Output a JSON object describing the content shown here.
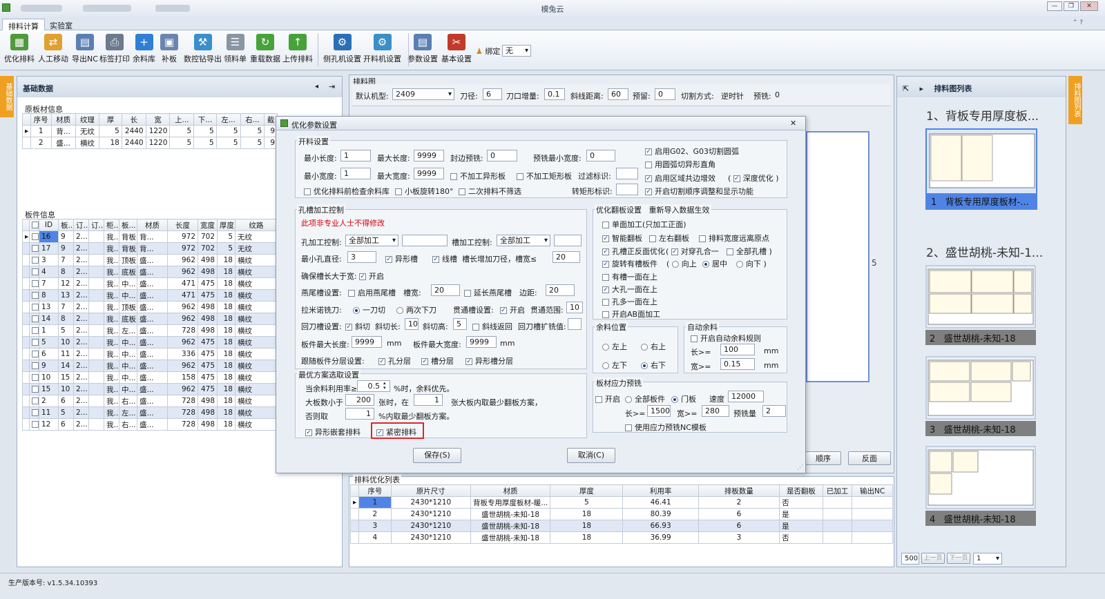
{
  "window": {
    "title": "模兔云",
    "min": "—",
    "max": "❐",
    "close": "✕"
  },
  "ribbon_tabs": [
    "排料计算",
    "实验室"
  ],
  "toolbar": [
    {
      "label": "优化排料",
      "color": "#4f9a3c",
      "glyph": "▦"
    },
    {
      "label": "人工移动",
      "color": "#e0a030",
      "glyph": "⇄"
    },
    {
      "label": "导出NC",
      "color": "#5b7fb4",
      "glyph": "▤"
    },
    {
      "label": "标签打印",
      "color": "#6b7a8c",
      "glyph": "⎙"
    },
    {
      "label": "余料库",
      "color": "#2f7fd4",
      "glyph": "+"
    },
    {
      "label": "补板",
      "color": "#6a86b0",
      "glyph": "▣"
    },
    {
      "label": "数控钻导出",
      "color": "#3a8fc9",
      "glyph": "⚒"
    },
    {
      "label": "领料单",
      "color": "#8a95a3",
      "glyph": "☰"
    },
    {
      "label": "重载数据",
      "color": "#46a33a",
      "glyph": "↻"
    },
    {
      "label": "上传排料",
      "color": "#46a33a",
      "glyph": "↑"
    },
    {
      "label": "侧孔机设置",
      "color": "#2b6fb8",
      "glyph": "⚙"
    },
    {
      "label": "开料机设置",
      "color": "#3a8fc9",
      "glyph": "⚙"
    },
    {
      "label": "参数设置",
      "color": "#5b7fb4",
      "glyph": "▤"
    },
    {
      "label": "基本设置",
      "color": "#c23a2a",
      "glyph": "✂"
    }
  ],
  "bind": {
    "label": "绑定",
    "value": "无"
  },
  "left_panel": {
    "title": "基础数据",
    "side_tab": "基础数据",
    "raw_title": "原板材信息",
    "raw_headers": [
      "序号",
      "材质",
      "纹理",
      "厚",
      "长",
      "宽",
      "上...",
      "下...",
      "左...",
      "右...",
      "截"
    ],
    "raw_rows": [
      [
        "1",
        "背...",
        "无纹",
        "5",
        "2440",
        "1220",
        "5",
        "5",
        "5",
        "5",
        "9"
      ],
      [
        "2",
        "盛...",
        "横纹",
        "18",
        "2440",
        "1220",
        "5",
        "5",
        "5",
        "5",
        "9"
      ]
    ],
    "parts_title": "板件信息",
    "parts_headers": [
      "",
      "ID",
      "板...",
      "订...",
      "订...",
      "柜...",
      "板...",
      "材质",
      "长度",
      "宽度",
      "厚度",
      "纹路"
    ],
    "parts_rows": [
      [
        "16",
        "9",
        "2...",
        "",
        "我...",
        "背板",
        "背...",
        "972",
        "702",
        "5",
        "无纹"
      ],
      [
        "17",
        "9",
        "2...",
        "",
        "我...",
        "背板",
        "背...",
        "972",
        "702",
        "5",
        "无纹"
      ],
      [
        "3",
        "7",
        "2...",
        "",
        "我...",
        "顶板",
        "盛...",
        "962",
        "498",
        "18",
        "横纹"
      ],
      [
        "4",
        "8",
        "2...",
        "",
        "我...",
        "底板",
        "盛...",
        "962",
        "498",
        "18",
        "横纹"
      ],
      [
        "7",
        "12",
        "2...",
        "",
        "我...",
        "中...",
        "盛...",
        "471",
        "475",
        "18",
        "横纹"
      ],
      [
        "8",
        "13",
        "2...",
        "",
        "我...",
        "中...",
        "盛...",
        "471",
        "475",
        "18",
        "横纹"
      ],
      [
        "13",
        "7",
        "2...",
        "",
        "我...",
        "顶板",
        "盛...",
        "962",
        "498",
        "18",
        "横纹"
      ],
      [
        "14",
        "8",
        "2...",
        "",
        "我...",
        "底板",
        "盛...",
        "962",
        "498",
        "18",
        "横纹"
      ],
      [
        "1",
        "5",
        "2...",
        "",
        "我...",
        "左...",
        "盛...",
        "728",
        "498",
        "18",
        "横纹"
      ],
      [
        "5",
        "10",
        "2...",
        "",
        "我...",
        "中...",
        "盛...",
        "962",
        "475",
        "18",
        "横纹"
      ],
      [
        "6",
        "11",
        "2...",
        "",
        "我...",
        "中...",
        "盛...",
        "336",
        "475",
        "18",
        "横纹"
      ],
      [
        "9",
        "14",
        "2...",
        "",
        "我...",
        "中...",
        "盛...",
        "962",
        "475",
        "18",
        "横纹"
      ],
      [
        "10",
        "15",
        "2...",
        "",
        "我...",
        "中...",
        "盛...",
        "158",
        "475",
        "18",
        "横纹"
      ],
      [
        "15",
        "10",
        "2...",
        "",
        "我...",
        "中...",
        "盛...",
        "962",
        "475",
        "18",
        "横纹"
      ],
      [
        "2",
        "6",
        "2...",
        "",
        "我...",
        "右...",
        "盛...",
        "728",
        "498",
        "18",
        "横纹"
      ],
      [
        "11",
        "5",
        "2...",
        "",
        "我...",
        "左...",
        "盛...",
        "728",
        "498",
        "18",
        "横纹"
      ],
      [
        "12",
        "6",
        "2...",
        "",
        "我...",
        "右...",
        "盛...",
        "728",
        "498",
        "18",
        "横纹"
      ]
    ]
  },
  "layout_panel": {
    "title": "排料图",
    "machine_label": "默认机型:",
    "machine_value": "2409",
    "knife_label": "刀径:",
    "knife_value": "6",
    "margin_label": "刀口增量:",
    "margin_value": "0.1",
    "slope_label": "斜线距离:",
    "slope_value": "60",
    "reserve_label": "预留:",
    "reserve_value": "0",
    "cut_label": "切割方式:",
    "cut_value": "逆时针",
    "pre_label": "预铣:",
    "pre_value": "0",
    "board_mark": "5",
    "btn_order": "顺序",
    "btn_back": "反面"
  },
  "opt_list": {
    "title": "排料优化列表",
    "headers": [
      "",
      "序号",
      "原片尺寸",
      "材质",
      "厚度",
      "利用率",
      "排板数量",
      "是否翻板",
      "已加工",
      "输出NC"
    ],
    "rows": [
      [
        "1",
        "2430*1210",
        "背板专用厚度板材-暖...",
        "5",
        "46.41",
        "2",
        "否",
        "",
        ""
      ],
      [
        "2",
        "2430*1210",
        "盛世胡桃-未知-18",
        "18",
        "80.39",
        "6",
        "是",
        "",
        ""
      ],
      [
        "3",
        "2430*1210",
        "盛世胡桃-未知-18",
        "18",
        "66.93",
        "6",
        "是",
        "",
        ""
      ],
      [
        "4",
        "2430*1210",
        "盛世胡桃-未知-18",
        "18",
        "36.99",
        "3",
        "否",
        "",
        ""
      ]
    ]
  },
  "right_panel": {
    "title": "排料图列表",
    "side_tab": "排料图列表",
    "groups": [
      {
        "heading": "1、背板专用厚度板...",
        "cards": [
          {
            "num": "1",
            "name": "背板专用厚度板材-..."
          }
        ]
      },
      {
        "heading": "2、盛世胡桃-未知-1...",
        "cards": [
          {
            "num": "2",
            "name": "盛世胡桃-未知-18"
          },
          {
            "num": "3",
            "name": "盛世胡桃-未知-18"
          },
          {
            "num": "4",
            "name": "盛世胡桃-未知-18"
          }
        ]
      }
    ],
    "pager": {
      "size": "500",
      "prev": "上一页",
      "next": "下一页",
      "page": "1"
    }
  },
  "dialog": {
    "title": "优化参数设置",
    "close": "✕",
    "g_cut": "开料设置",
    "min_len": "最小长度:",
    "min_len_v": "1",
    "max_len": "最大长度:",
    "max_len_v": "9999",
    "edge_pre": "封边预铣:",
    "edge_pre_v": "0",
    "pre_min_w": "预铣最小宽度:",
    "pre_min_w_v": "0",
    "min_w": "最小宽度:",
    "min_w_v": "1",
    "max_w": "最大宽度:",
    "max_w_v": "9999",
    "no_shape": "不加工异形板",
    "no_rect": "不加工矩形板",
    "filter_mark": "过滤标识:",
    "rot_mark": "转矩形标识:",
    "check_remain": "优化排料前检查余料库",
    "rot180": "小板旋转180°",
    "second": "二次排料不筛选",
    "g02": "启用G02、G03切割圆弧",
    "arc": "用圆弧切异形直角",
    "region": "启用区域共边增效",
    "deep": "深度优化",
    "order_fn": "开启切割顺序调整和显示功能",
    "g_hole": "孔槽加工控制",
    "warn": "此项非专业人士不得修改",
    "hole_ctrl": "孔加工控制:",
    "hole_ctrl_v": "全部加工",
    "slot_ctrl": "槽加工控制:",
    "slot_ctrl_v": "全部加工",
    "min_dia": "最小孔直径:",
    "min_dia_v": "3",
    "shape_slot": "异形槽",
    "line_slot": "线槽",
    "slot_add": "槽长增加刀径，槽宽≤",
    "slot_add_v": "20",
    "keep_len": "确保槽长大于宽:",
    "open": "开启",
    "dove": "燕尾槽设置:",
    "dove_on": "启用燕尾槽",
    "slot_w": "槽宽:",
    "slot_w_v": "20",
    "ext_dove": "延长燕尾槽",
    "edge": "边距:",
    "edge_v": "20",
    "lamino": "拉米诺铣刀:",
    "one_cut": "一刀切",
    "two_cut": "两次下刀",
    "through": "贯通槽设置:",
    "range": "贯通范围:",
    "range_v": "10",
    "back": "回刀槽设置:",
    "oblique": "斜切",
    "ob_len": "斜切长:",
    "ob_len_v": "10",
    "ob_h": "斜切高:",
    "ob_h_v": "5",
    "ob_back": "斜线返回",
    "back_ext": "回刀槽扩铣值:",
    "max_plen": "板件最大长度:",
    "max_plen_v": "9999",
    "mm": "mm",
    "max_pw": "板件最大宽度:",
    "max_pw_v": "9999",
    "follow": "跟随板件分层设置:",
    "hole_layer": "孔分层",
    "slot_layer": "槽分层",
    "shape_layer": "异形槽分层",
    "g_flip": "优化翻板设置",
    "reimport": "重新导入数据生效",
    "single": "单面加工(只加工正面)",
    "smart": "智能翻板",
    "lr": "左右翻板",
    "width_far": "排料宽度远离原点",
    "hole_pos": "孔槽正反面优化",
    "pair": "对穿孔合一",
    "all_slot": "全部孔槽",
    "rot_slot": "旋转有槽板件",
    "up": "向上",
    "mid": "居中",
    "down": "向下",
    "slot_one": "有槽一面在上",
    "big_hole": "大孔一面在上",
    "more_hole": "孔多一面在上",
    "ab": "开启AB面加工",
    "g_remain": "余料位置",
    "lt": "左上",
    "rt": "右上",
    "lb": "左下",
    "rb": "右下",
    "g_auto": "自动余料",
    "auto_on": "开启自动余料规则",
    "len_ge": "长>=",
    "len_ge_v": "100",
    "w_ge": "宽>=",
    "w_ge_v": "0.15",
    "g_best": "最优方案选取设置",
    "cur_rate": "当余料利用率≥",
    "cur_rate_v": "0.5",
    "cur_rate_t": "%时，余料优先。",
    "big_less": "大板数小于",
    "big_less_v": "200",
    "big_less_m": "张时，在",
    "big_less_v2": "1",
    "big_less_t": "张大板内取最少翻板方案，",
    "else": "否则取",
    "else_v": "1",
    "else_t": "%内取最少翻板方案。",
    "nest": "异形嵌套排料",
    "tight": "紧密排料",
    "g_stress": "板材应力预铣",
    "st_on": "开启",
    "all_parts": "全部板件",
    "doors": "门板",
    "speed": "速度",
    "speed_v": "12000",
    "st_len": "长>=",
    "st_len_v": "1500",
    "st_w": "宽>=",
    "st_w_v": "280",
    "pre_amount": "预铣量",
    "pre_amount_v": "2",
    "nc_tpl": "使用应力预铣NC模板",
    "save": "保存(S)",
    "cancel": "取消(C)"
  },
  "status": {
    "version": "生产版本号:  v1.5.34.10393"
  },
  "colors": {
    "accent": "#f0a020",
    "highlight": "#e0242c",
    "selected_row": "#4f84e6"
  }
}
